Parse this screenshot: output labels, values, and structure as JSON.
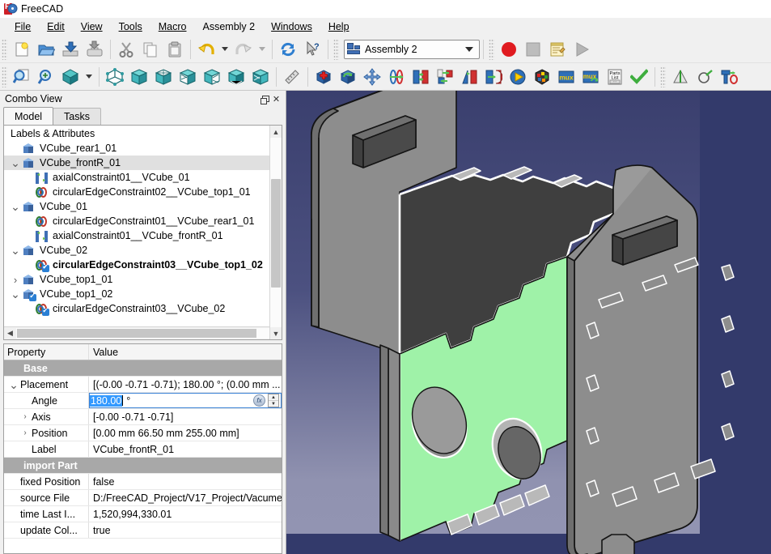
{
  "window": {
    "title": "FreeCAD",
    "app_icon": "freecad-logo-icon"
  },
  "menubar": {
    "items": [
      {
        "label": "File"
      },
      {
        "label": "Edit"
      },
      {
        "label": "View"
      },
      {
        "label": "Tools"
      },
      {
        "label": "Macro"
      },
      {
        "label": "Assembly 2"
      },
      {
        "label": "Windows"
      },
      {
        "label": "Help"
      }
    ]
  },
  "toolbar_file": {
    "buttons": [
      {
        "name": "new-document-icon",
        "title": "New"
      },
      {
        "name": "open-document-icon",
        "title": "Open"
      },
      {
        "name": "save-document-icon",
        "title": "Save"
      },
      {
        "name": "print-document-icon",
        "title": "Print"
      },
      {
        "name": "cut-icon",
        "title": "Cut"
      },
      {
        "name": "copy-icon",
        "title": "Copy"
      },
      {
        "name": "paste-icon",
        "title": "Paste"
      },
      {
        "name": "undo-icon",
        "title": "Undo"
      },
      {
        "name": "undo-dropdown-icon",
        "title": "Undo history"
      },
      {
        "name": "redo-icon",
        "title": "Redo"
      },
      {
        "name": "redo-dropdown-icon",
        "title": "Redo history"
      },
      {
        "name": "refresh-icon",
        "title": "Refresh"
      },
      {
        "name": "whats-this-icon",
        "title": "What's This"
      }
    ]
  },
  "workbench": {
    "label": "Assembly 2",
    "icon": "workbench-icon"
  },
  "toolbar_macro": {
    "buttons": [
      {
        "name": "macro-record-icon",
        "title": "Macro recording"
      },
      {
        "name": "macro-stop-icon",
        "title": "Stop macro recording"
      },
      {
        "name": "macro-edit-icon",
        "title": "Macros"
      },
      {
        "name": "macro-execute-icon",
        "title": "Execute macro"
      }
    ]
  },
  "toolbar_view": {
    "buttons": [
      {
        "name": "fit-all-icon",
        "title": "Fit all"
      },
      {
        "name": "fit-selection-icon",
        "title": "Fit selection"
      },
      {
        "name": "draw-style-icon",
        "title": "Draw style"
      },
      {
        "name": "draw-style-dropdown-icon",
        "title": "Draw style menu"
      },
      {
        "name": "axonometric-view-icon",
        "title": "Axonometric"
      },
      {
        "name": "front-view-icon",
        "title": "Front"
      },
      {
        "name": "top-view-icon",
        "title": "Top"
      },
      {
        "name": "right-view-icon",
        "title": "Right"
      },
      {
        "name": "rear-view-icon",
        "title": "Rear"
      },
      {
        "name": "bottom-view-icon",
        "title": "Bottom"
      },
      {
        "name": "left-view-icon",
        "title": "Left"
      },
      {
        "name": "measure-icon",
        "title": "Measure"
      }
    ]
  },
  "toolbar_assembly": {
    "buttons": [
      {
        "name": "import-part-icon",
        "title": "Import part"
      },
      {
        "name": "update-parts-icon",
        "title": "Update imported parts"
      },
      {
        "name": "move-part-icon",
        "title": "Move part"
      },
      {
        "name": "axial-constraint-icon",
        "title": "Axial constraint"
      },
      {
        "name": "plane-constraint-icon",
        "title": "Plane constraint"
      },
      {
        "name": "circular-edge-constraint-icon",
        "title": "Circular edge constraint"
      },
      {
        "name": "angle-constraint-icon",
        "title": "Angle constraint"
      },
      {
        "name": "spherical-constraint-icon",
        "title": "Spherical constraint"
      },
      {
        "name": "solve-constraints-icon",
        "title": "Solve constraints"
      },
      {
        "name": "degrees-of-freedom-icon",
        "title": "Degrees of freedom animation"
      },
      {
        "name": "muxed-assembly-icon",
        "title": "Muxed assembly"
      },
      {
        "name": "update-muxed-icon",
        "title": "Update muxed assembly"
      },
      {
        "name": "parts-list-icon",
        "title": "Parts list"
      },
      {
        "name": "check-assembly-icon",
        "title": "Check assembly"
      }
    ]
  },
  "toolbar_extra": {
    "buttons": [
      {
        "name": "mirror-part-icon",
        "title": "Mirror part"
      },
      {
        "name": "shape-reference-icon",
        "title": "Shape reference"
      },
      {
        "name": "edit-constraint-icon",
        "title": "Edit constraint"
      }
    ]
  },
  "combo_view": {
    "title": "Combo View",
    "float_button": "float-icon",
    "close_button": "close-icon",
    "tabs": [
      {
        "label": "Model",
        "active": true
      },
      {
        "label": "Tasks",
        "active": false
      }
    ],
    "tree_header": "Labels & Attributes",
    "tree_items": [
      {
        "label": "VCube_rear1_01",
        "depth": 1,
        "icon": "part-cube-icon",
        "arrow": "",
        "selected": false,
        "bold": false
      },
      {
        "label": "VCube_frontR_01",
        "depth": 1,
        "icon": "part-cube-icon",
        "arrow": "down",
        "selected": true,
        "bold": false
      },
      {
        "label": "axialConstraint01__VCube_01",
        "depth": 2,
        "icon": "axial-constraint-icon",
        "arrow": "",
        "selected": false,
        "bold": false
      },
      {
        "label": "circularEdgeConstraint02__VCube_top1_01",
        "depth": 2,
        "icon": "circular-edge-constraint-icon",
        "arrow": "",
        "selected": false,
        "bold": false
      },
      {
        "label": "VCube_01",
        "depth": 1,
        "icon": "part-cube-icon",
        "arrow": "down",
        "selected": false,
        "bold": false
      },
      {
        "label": "circularEdgeConstraint01__VCube_rear1_01",
        "depth": 2,
        "icon": "circular-edge-constraint-icon",
        "arrow": "",
        "selected": false,
        "bold": false
      },
      {
        "label": "axialConstraint01__VCube_frontR_01",
        "depth": 2,
        "icon": "axial-constraint-icon",
        "arrow": "",
        "selected": false,
        "bold": false
      },
      {
        "label": "VCube_02",
        "depth": 1,
        "icon": "part-cube-icon",
        "arrow": "down",
        "selected": false,
        "bold": false
      },
      {
        "label": "circularEdgeConstraint03__VCube_top1_02",
        "depth": 2,
        "icon": "circular-edge-constraint-checked-icon",
        "arrow": "",
        "selected": false,
        "bold": true
      },
      {
        "label": "VCube_top1_01",
        "depth": 1,
        "icon": "part-cube-icon",
        "arrow": "right",
        "selected": false,
        "bold": false
      },
      {
        "label": "VCube_top1_02",
        "depth": 1,
        "icon": "part-cube-checked-icon",
        "arrow": "down",
        "selected": false,
        "bold": false
      },
      {
        "label": "circularEdgeConstraint03__VCube_02",
        "depth": 2,
        "icon": "circular-edge-constraint-checked-icon",
        "arrow": "",
        "selected": false,
        "bold": false
      }
    ]
  },
  "property_editor": {
    "col_property": "Property",
    "col_value": "Value",
    "rows": [
      {
        "kind": "group",
        "key": "Base",
        "value": ""
      },
      {
        "kind": "row",
        "key": "Placement",
        "value": "[(-0.00 -0.71 -0.71); 180.00 °; (0.00 mm ...",
        "expander": "down",
        "indent": 0
      },
      {
        "kind": "edit",
        "key": "Angle",
        "value": "180.00",
        "unit": "°",
        "expander": "none",
        "indent": 1
      },
      {
        "kind": "row",
        "key": "Axis",
        "value": "[-0.00 -0.71 -0.71]",
        "expander": "right",
        "indent": 1
      },
      {
        "kind": "row",
        "key": "Position",
        "value": "[0.00 mm  66.50 mm  255.00 mm]",
        "expander": "right",
        "indent": 1
      },
      {
        "kind": "row",
        "key": "Label",
        "value": "VCube_frontR_01",
        "expander": "none",
        "indent": 1
      },
      {
        "kind": "group",
        "key": "import Part",
        "value": ""
      },
      {
        "kind": "row",
        "key": "fixed Position",
        "value": "false",
        "expander": "none",
        "indent": 0
      },
      {
        "kind": "row",
        "key": "source File",
        "value": "D:/FreeCAD_Project/V17_Project/Vacume...",
        "expander": "none",
        "indent": 0
      },
      {
        "kind": "row",
        "key": "time Last I...",
        "value": "1,520,994,330.01",
        "expander": "none",
        "indent": 0
      },
      {
        "kind": "row",
        "key": "update Col...",
        "value": "true",
        "expander": "none",
        "indent": 0
      }
    ],
    "formula_icon": "formula-expression-icon",
    "spinner_icon": "spinner-arrows-icon"
  },
  "viewport": {
    "name": "3d-view",
    "background_top": "#3a3f6e",
    "background_bottom": "#9294b2",
    "outside_color": "#373d6d",
    "model_description": "Isometric view of a laser-cut vacuum enclosure assembly with interlocking tabbed panels",
    "colors": {
      "selected_face": "#9bf2a5",
      "panel_face": "#8c8c8c",
      "panel_face_dark": "#4a4a4a",
      "panel_edge": "#ffffff",
      "outline": "#151515"
    }
  }
}
